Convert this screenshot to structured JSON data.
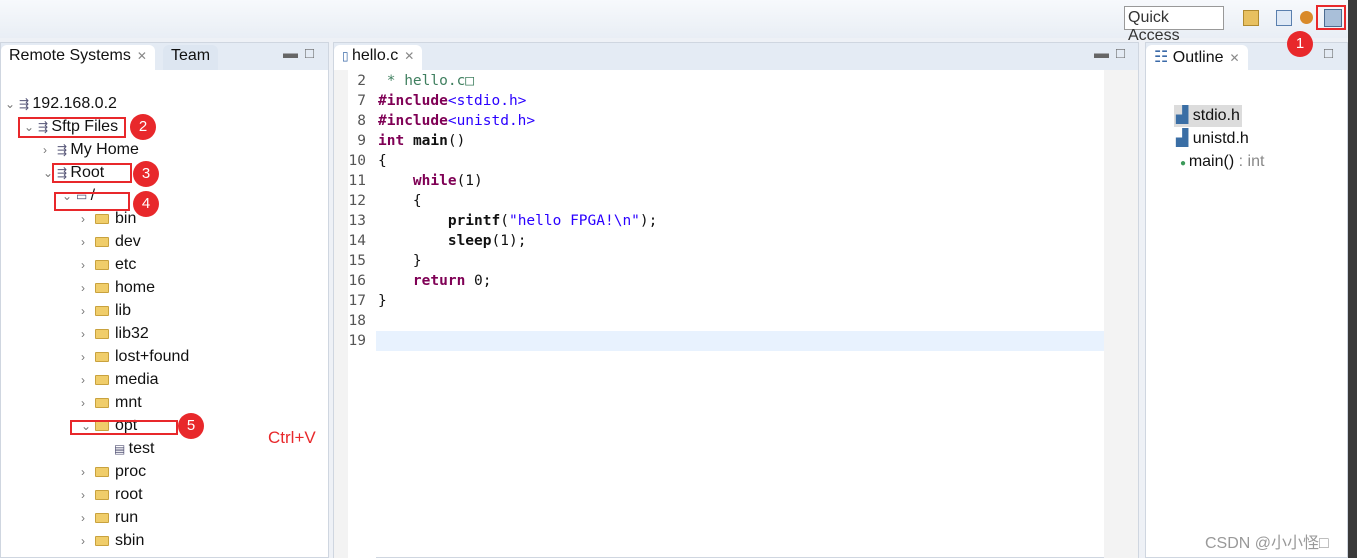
{
  "toolbar": {
    "quick_access": "Quick Access"
  },
  "remote_panel": {
    "tabs": [
      "Remote Systems",
      "Team"
    ],
    "tree": [
      {
        "label": "192.168.0.2",
        "depth": 0,
        "arrow": "v",
        "icon": "host"
      },
      {
        "label": "Sftp Files",
        "depth": 1,
        "arrow": "v",
        "icon": "files"
      },
      {
        "label": "My Home",
        "depth": 2,
        "arrow": ">",
        "icon": "root"
      },
      {
        "label": "Root",
        "depth": 2,
        "arrow": "v",
        "icon": "root"
      },
      {
        "label": "/",
        "depth": 3,
        "arrow": "v",
        "icon": "drive"
      },
      {
        "label": "bin",
        "depth": 4,
        "arrow": ">",
        "icon": "folder"
      },
      {
        "label": "dev",
        "depth": 4,
        "arrow": ">",
        "icon": "folder"
      },
      {
        "label": "etc",
        "depth": 4,
        "arrow": ">",
        "icon": "folder"
      },
      {
        "label": "home",
        "depth": 4,
        "arrow": ">",
        "icon": "folder"
      },
      {
        "label": "lib",
        "depth": 4,
        "arrow": ">",
        "icon": "folder"
      },
      {
        "label": "lib32",
        "depth": 4,
        "arrow": ">",
        "icon": "folder"
      },
      {
        "label": "lost+found",
        "depth": 4,
        "arrow": ">",
        "icon": "folder"
      },
      {
        "label": "media",
        "depth": 4,
        "arrow": ">",
        "icon": "folder"
      },
      {
        "label": "mnt",
        "depth": 4,
        "arrow": ">",
        "icon": "folder"
      },
      {
        "label": "opt",
        "depth": 4,
        "arrow": "v",
        "icon": "folder-open"
      },
      {
        "label": "test",
        "depth": 5,
        "arrow": "",
        "icon": "file"
      },
      {
        "label": "proc",
        "depth": 4,
        "arrow": ">",
        "icon": "folder"
      },
      {
        "label": "root",
        "depth": 4,
        "arrow": ">",
        "icon": "folder"
      },
      {
        "label": "run",
        "depth": 4,
        "arrow": ">",
        "icon": "folder"
      },
      {
        "label": "sbin",
        "depth": 4,
        "arrow": ">",
        "icon": "folder"
      }
    ]
  },
  "editor": {
    "tab": "hello.c",
    "lines": [
      {
        "n": "2",
        "html": "<span class='cm'> * hello.c□</span>"
      },
      {
        "n": "7",
        "html": "<span class='kw'>#include</span><span class='str'>&lt;stdio.h&gt;</span>"
      },
      {
        "n": "8",
        "html": "<span class='kw'>#include</span><span class='str'>&lt;unistd.h&gt;</span>"
      },
      {
        "n": "9",
        "html": "<span class='kw'>int</span> <b>main</b>()"
      },
      {
        "n": "10",
        "html": "{"
      },
      {
        "n": "11",
        "html": "    <span class='kw'>while</span>(1)"
      },
      {
        "n": "12",
        "html": "    {"
      },
      {
        "n": "13",
        "html": "        <b>printf</b>(<span class='str'>\"hello FPGA!\\n\"</span>);"
      },
      {
        "n": "14",
        "html": "        <b>sleep</b>(1);"
      },
      {
        "n": "15",
        "html": "    }"
      },
      {
        "n": "16",
        "html": "    <span class='kw'>return</span> 0;"
      },
      {
        "n": "17",
        "html": "}"
      },
      {
        "n": "18",
        "html": ""
      },
      {
        "n": "19",
        "html": ""
      }
    ]
  },
  "outline": {
    "tab": "Outline",
    "items": [
      {
        "label": "stdio.h",
        "type": ""
      },
      {
        "label": "unistd.h",
        "type": ""
      },
      {
        "label": "main()",
        "type": " : int"
      }
    ]
  },
  "annotations": {
    "badges": [
      "1",
      "2",
      "3",
      "4",
      "5"
    ],
    "hint": "Ctrl+V",
    "accent": "#e8282b"
  },
  "watermark": "CSDN @小小怪□"
}
